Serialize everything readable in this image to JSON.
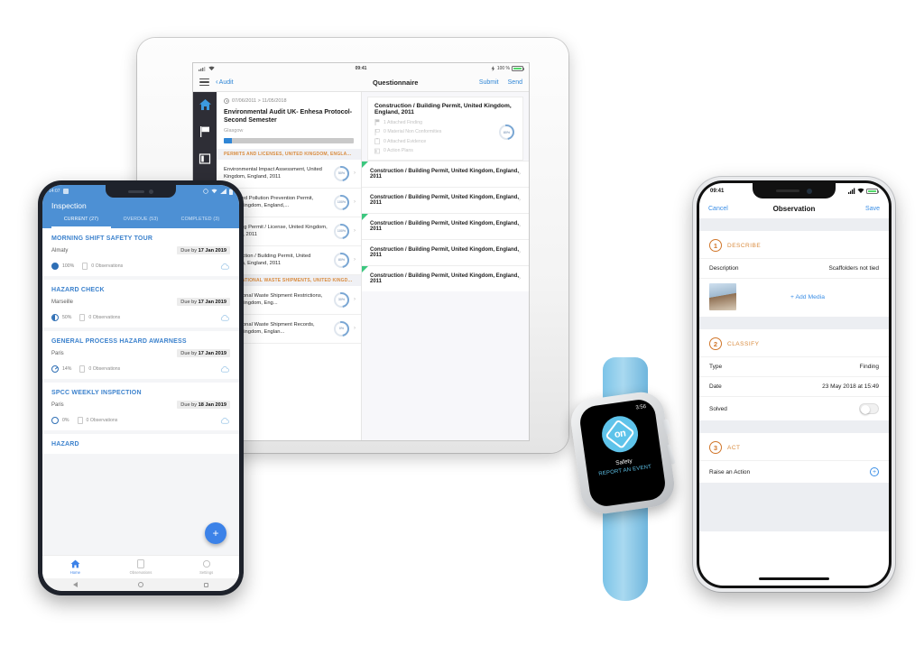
{
  "tablet": {
    "status": {
      "time": "09:41",
      "battery": "100 %"
    },
    "nav": {
      "back": "Audit",
      "title_left": "Questionnaire",
      "submit": "Submit",
      "send": "Send"
    },
    "rail": [
      {
        "icon": "home-icon",
        "active": true
      },
      {
        "icon": "flag-icon",
        "active": false
      },
      {
        "icon": "book-icon",
        "active": false
      }
    ],
    "audit": {
      "date_range": "07/06/2011 > 11/05/2018",
      "title": "Environmental Audit UK- Enhesa Protocol-Second Semester",
      "location": "Glasgow",
      "progress": 6
    },
    "left_sections": [
      {
        "header": "PERMITS AND LICENSES, UNITED KINGDOM, ENGLA...",
        "items": [
          {
            "text": "Environmental Impact Assessment, United Kingdom, England, 2011",
            "pct": "50%"
          },
          {
            "text": "Integrated Pollution Prevention Permit, United Kingdom, England,...",
            "pct": "100%"
          },
          {
            "text": "Operating Permit / License, United Kingdom, England, 2011",
            "pct": "100%"
          },
          {
            "text": "Construction / Building Permit, United Kingdom, England, 2011",
            "pct": "80%"
          }
        ]
      },
      {
        "header": "INTERNATIONAL WASTE SHIPMENTS, UNITED KINGD...",
        "items": [
          {
            "text": "International Waste Shipment Restrictions, United Kingdom, Eng...",
            "pct": "30%"
          },
          {
            "text": "International Waste Shipment Records, United Kingdom, Englan...",
            "pct": "0%"
          }
        ]
      }
    ],
    "question_card": {
      "title": "Construction / Building Permit, United Kingdom, England, 2011",
      "pct": "80%",
      "meta": [
        {
          "icon": "flag-icon",
          "text": "1 Attached Finding"
        },
        {
          "icon": "flag-outline-icon",
          "text": "0 Material Non Conformities"
        },
        {
          "icon": "clipboard-icon",
          "text": "0 Attached Evidence"
        },
        {
          "icon": "book-icon",
          "text": "0 Action Plans"
        }
      ]
    },
    "question_rows": [
      {
        "text": "Construction / Building Permit, United Kingdom, England, 2011",
        "flagged": true
      },
      {
        "text": "Construction / Building Permit, United Kingdom, England, 2011",
        "flagged": false
      },
      {
        "text": "Construction / Building Permit, United Kingdom, England, 2011",
        "flagged": true
      },
      {
        "text": "Construction / Building Permit, United Kingdom, England, 2011",
        "flagged": false
      },
      {
        "text": "Construction / Building Permit, United Kingdom, England, 2011",
        "flagged": true
      }
    ]
  },
  "android": {
    "status": {
      "time": "14:07"
    },
    "header": {
      "title": "Inspection"
    },
    "tabs": [
      {
        "label": "CURRENT (27)",
        "active": true
      },
      {
        "label": "OVERDUE (53)",
        "active": false
      },
      {
        "label": "COMPLETED (3)",
        "active": false
      }
    ],
    "cards": [
      {
        "title": "MORNING SHIFT SAFETY TOUR",
        "city": "Almaty",
        "due_prefix": "Due by ",
        "due_date": "17 Jan 2019",
        "pct": "100%",
        "observations": "0 Observations",
        "progress_style": "full"
      },
      {
        "title": "HAZARD CHECK",
        "city": "Marseille",
        "due_prefix": "Due by ",
        "due_date": "17 Jan 2019",
        "pct": "50%",
        "observations": "0 Observations",
        "progress_style": "half"
      },
      {
        "title": "GENERAL PROCESS HAZARD AWARNESS",
        "city": "Paris",
        "due_prefix": "Due by ",
        "due_date": "17 Jan 2019",
        "pct": "14%",
        "observations": "0 Observations",
        "progress_style": "low"
      },
      {
        "title": "SPCC WEEKLY INSPECTION",
        "city": "Paris",
        "due_prefix": "Due by ",
        "due_date": "18 Jan 2019",
        "pct": "0%",
        "observations": "0 Observations",
        "progress_style": "empty"
      },
      {
        "title": "HAZARD",
        "city": "",
        "due_prefix": "",
        "due_date": "",
        "pct": "",
        "observations": "",
        "progress_style": "empty"
      }
    ],
    "fab_label": "+",
    "bottom_nav": [
      {
        "label": "Home",
        "icon": "home-icon",
        "active": true
      },
      {
        "label": "Observations",
        "icon": "document-icon",
        "active": false
      },
      {
        "label": "Settings",
        "icon": "gear-icon",
        "active": false
      }
    ]
  },
  "iphone": {
    "status": {
      "time": "09:41"
    },
    "nav": {
      "cancel": "Cancel",
      "title": "Observation",
      "save": "Save"
    },
    "sections": [
      {
        "num": "1",
        "label": "DESCRIBE"
      },
      {
        "num": "2",
        "label": "CLASSIFY"
      },
      {
        "num": "3",
        "label": "ACT"
      }
    ],
    "describe": {
      "desc_key": "Description",
      "desc_value": "Scaffolders not tied",
      "add_media": "+ Add Media"
    },
    "classify": {
      "type_key": "Type",
      "type_value": "Finding",
      "date_key": "Date",
      "date_value": "23 May 2018 at 15:49",
      "solved_key": "Solved"
    },
    "act": {
      "raise_key": "Raise an Action"
    }
  },
  "watch": {
    "time": "3:56",
    "logo_text": "on",
    "line1": "Safety",
    "line2": "REPORT AN EVENT"
  },
  "colors": {
    "android_blue": "#4d90d4",
    "ios_blue": "#3a8ee6",
    "accent_orange": "#d98b3e",
    "flag_green": "#3cc77f",
    "watch_cyan": "#5ec3ea"
  }
}
